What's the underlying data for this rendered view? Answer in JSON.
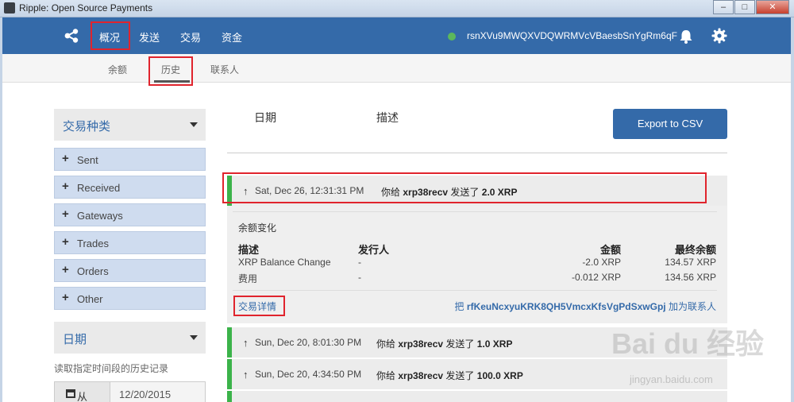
{
  "window": {
    "title": "Ripple: Open Source Payments",
    "minimize": "–",
    "maximize": "□",
    "close": "✕"
  },
  "topnav": {
    "items": [
      "概况",
      "发送",
      "交易",
      "资金"
    ],
    "address": "rsnXVu9MWQXVDQWRMVcVBaesbSnYgRm6qF",
    "status_color": "#5cb85c",
    "icons": [
      "ripple-logo-icon",
      "bell-icon",
      "gear-icon"
    ]
  },
  "subnav": {
    "items": [
      "余额",
      "历史",
      "联系人"
    ]
  },
  "sidebar": {
    "type_filter_title": "交易种类",
    "filters": [
      "Sent",
      "Received",
      "Gateways",
      "Trades",
      "Orders",
      "Other"
    ],
    "date_title": "日期",
    "date_hint": "读取指定时间段的历史记录",
    "from_label": "从",
    "from_value": "12/20/2015"
  },
  "main": {
    "col_date": "日期",
    "col_desc": "描述",
    "export_label": "Export to CSV",
    "transactions": [
      {
        "time": "Sat, Dec 26, 12:31:31 PM",
        "prefix": "你给",
        "to": "xrp38recv",
        "verb": "发送了",
        "amount": "2.0 XRP"
      },
      {
        "time": "Sun, Dec 20, 8:01:30 PM",
        "prefix": "你给",
        "to": "xrp38recv",
        "verb": "发送了",
        "amount": "1.0 XRP"
      },
      {
        "time": "Sun, Dec 20, 4:34:50 PM",
        "prefix": "你给",
        "to": "xrp38recv",
        "verb": "发送了",
        "amount": "100.0 XRP"
      }
    ],
    "detail": {
      "section_title": "余额变化",
      "headers": [
        "描述",
        "发行人",
        "金额",
        "最终余额"
      ],
      "rows": [
        {
          "desc": "XRP Balance Change",
          "issuer": "-",
          "amount": "-2.0 XRP",
          "final": "134.57 XRP"
        },
        {
          "desc": "费用",
          "issuer": "-",
          "amount": "-0.012 XRP",
          "final": "134.56 XRP"
        }
      ],
      "details_link": "交易详情",
      "add_prefix": "把",
      "add_address": "rfKeuNcxyuKRK8QH5VmcxKfsVgPdSxwGpj",
      "add_suffix": "加为联系人"
    }
  },
  "watermark": {
    "text": "Bai du 经验",
    "sub": "jingyan.baidu.com"
  },
  "colors": {
    "nav": "#346aa9",
    "accent": "#e0242d",
    "success": "#3bb34a",
    "filter_bg": "#cfdcef"
  }
}
